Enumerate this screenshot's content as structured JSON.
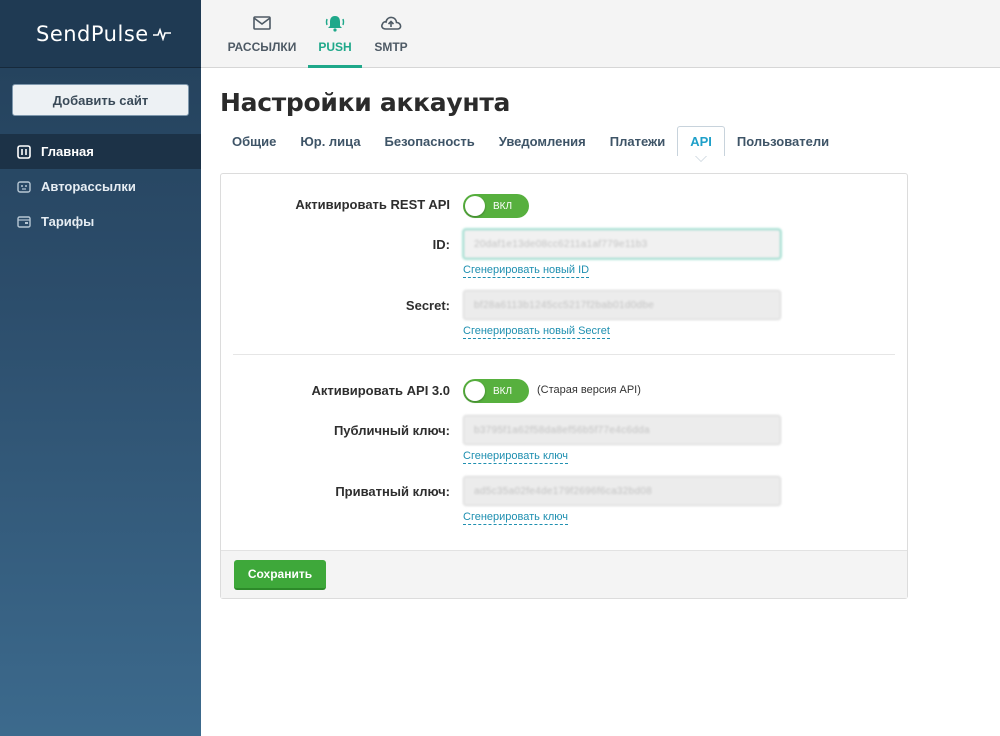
{
  "sidebar": {
    "logo": "SendPulse",
    "add_site": "Добавить сайт",
    "items": [
      {
        "label": "Главная",
        "icon": "dashboard-icon",
        "active": true
      },
      {
        "label": "Авторассылки",
        "icon": "robot-icon",
        "active": false
      },
      {
        "label": "Тарифы",
        "icon": "wallet-icon",
        "active": false
      }
    ]
  },
  "topnav": {
    "items": [
      {
        "label": "РАССЫЛКИ",
        "icon": "envelope-icon",
        "active": false
      },
      {
        "label": "PUSH",
        "icon": "bell-icon",
        "active": true
      },
      {
        "label": "SMTP",
        "icon": "cloud-upload-icon",
        "active": false
      }
    ]
  },
  "main": {
    "title": "Настройки аккаунта",
    "tabs": [
      {
        "label": "Общие",
        "active": false
      },
      {
        "label": "Юр. лица",
        "active": false
      },
      {
        "label": "Безопасность",
        "active": false
      },
      {
        "label": "Уведомления",
        "active": false
      },
      {
        "label": "Платежи",
        "active": false
      },
      {
        "label": "API",
        "active": true
      },
      {
        "label": "Пользователи",
        "active": false
      }
    ]
  },
  "form": {
    "rest_api_label": "Активировать REST API",
    "rest_api_toggle": "ВКЛ",
    "id_label": "ID:",
    "id_value": "20daf1e13de08cc6211a1af779e11b3",
    "id_link": "Сгенерировать новый ID",
    "secret_label": "Secret:",
    "secret_value": "bf28a6113b1245cc5217f2bab01d0dbe",
    "secret_link": "Сгенерировать новый Secret",
    "api3_label": "Активировать API 3.0",
    "api3_toggle": "ВКЛ",
    "api3_note": "(Старая версия API)",
    "public_key_label": "Публичный ключ:",
    "public_key_value": "b3795f1a62f58da8ef56b5f77e4c6dda",
    "public_key_link": "Сгенерировать ключ",
    "private_key_label": "Приватный ключ:",
    "private_key_value": "ad5c35a02fe4de179f2696f6ca32bd08",
    "private_key_link": "Сгенерировать ключ",
    "save_label": "Сохранить"
  },
  "colors": {
    "accent": "#1fa88a",
    "toggle_on": "#57b03e",
    "save_button": "#3ea83a",
    "link": "#1e8fb0",
    "sidebar_bg": "#2c4d6b"
  }
}
